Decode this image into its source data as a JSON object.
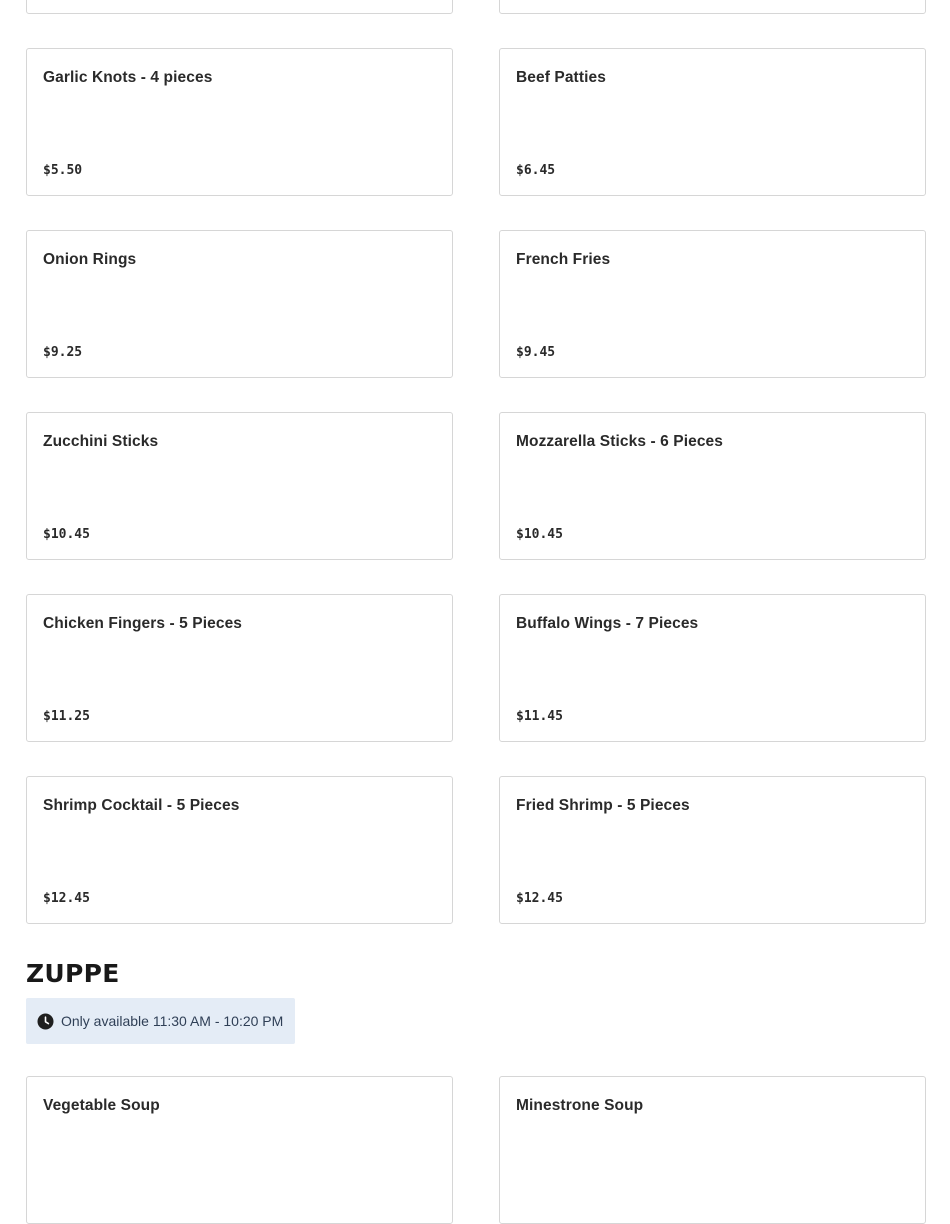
{
  "items_top": [
    {
      "name": "Garlic Knots - 4 pieces",
      "price": "$5.50"
    },
    {
      "name": "Beef Patties",
      "price": "$6.45"
    },
    {
      "name": "Onion Rings",
      "price": "$9.25"
    },
    {
      "name": "French Fries",
      "price": "$9.45"
    },
    {
      "name": "Zucchini Sticks",
      "price": "$10.45"
    },
    {
      "name": "Mozzarella Sticks - 6 Pieces",
      "price": "$10.45"
    },
    {
      "name": "Chicken Fingers - 5 Pieces",
      "price": "$11.25"
    },
    {
      "name": "Buffalo Wings - 7 Pieces",
      "price": "$11.45"
    },
    {
      "name": "Shrimp Cocktail - 5 Pieces",
      "price": "$12.45"
    },
    {
      "name": "Fried Shrimp - 5 Pieces",
      "price": "$12.45"
    }
  ],
  "zuppe": {
    "title": "ZUPPE",
    "availability_icon": "clock-icon",
    "availability": "Only available 11:30 AM - 10:20 PM",
    "items": [
      {
        "name": "Vegetable Soup"
      },
      {
        "name": "Minestrone Soup"
      }
    ]
  },
  "colors": {
    "card_border": "#d6d6d6",
    "availability_bg": "#e4ecf6",
    "availability_text": "#2f3f56",
    "text": "#191919"
  }
}
